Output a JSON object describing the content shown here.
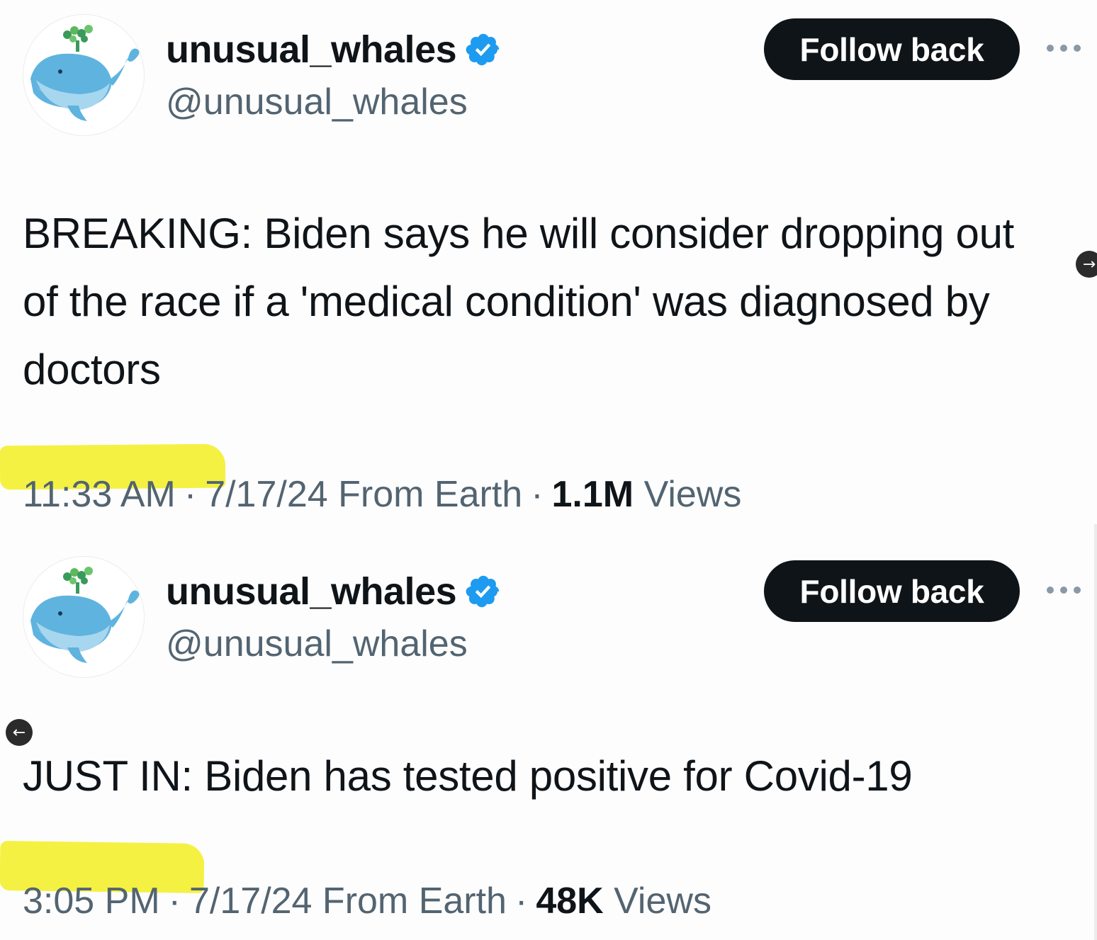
{
  "tweets": [
    {
      "display_name": "unusual_whales",
      "handle": "@unusual_whales",
      "follow_label": "Follow back",
      "text": "BREAKING: Biden says he will consider dropping out of the race if a 'medical condition' was diagnosed by doctors",
      "time": "11:33 AM",
      "date_source": "7/17/24 From Earth",
      "views_count": "1.1M",
      "views_label": "Views"
    },
    {
      "display_name": "unusual_whales",
      "handle": "@unusual_whales",
      "follow_label": "Follow back",
      "text": "JUST IN: Biden has tested positive for Covid-19",
      "time": "3:05 PM",
      "date_source": "7/17/24 From Earth",
      "views_count": "48K",
      "views_label": "Views"
    }
  ],
  "icons": {
    "verified": "verified-badge-icon",
    "more": "more-dots-icon",
    "avatar": "whale-avatar",
    "next": "arrow-right-icon",
    "prev": "arrow-left-icon"
  },
  "nav": {
    "next_glyph": "→",
    "prev_glyph": "←"
  },
  "colors": {
    "text": "#0f1419",
    "muted": "#536471",
    "verified": "#1d9bf0",
    "highlight": "#f3ef2f",
    "button_bg": "#0f1419"
  }
}
